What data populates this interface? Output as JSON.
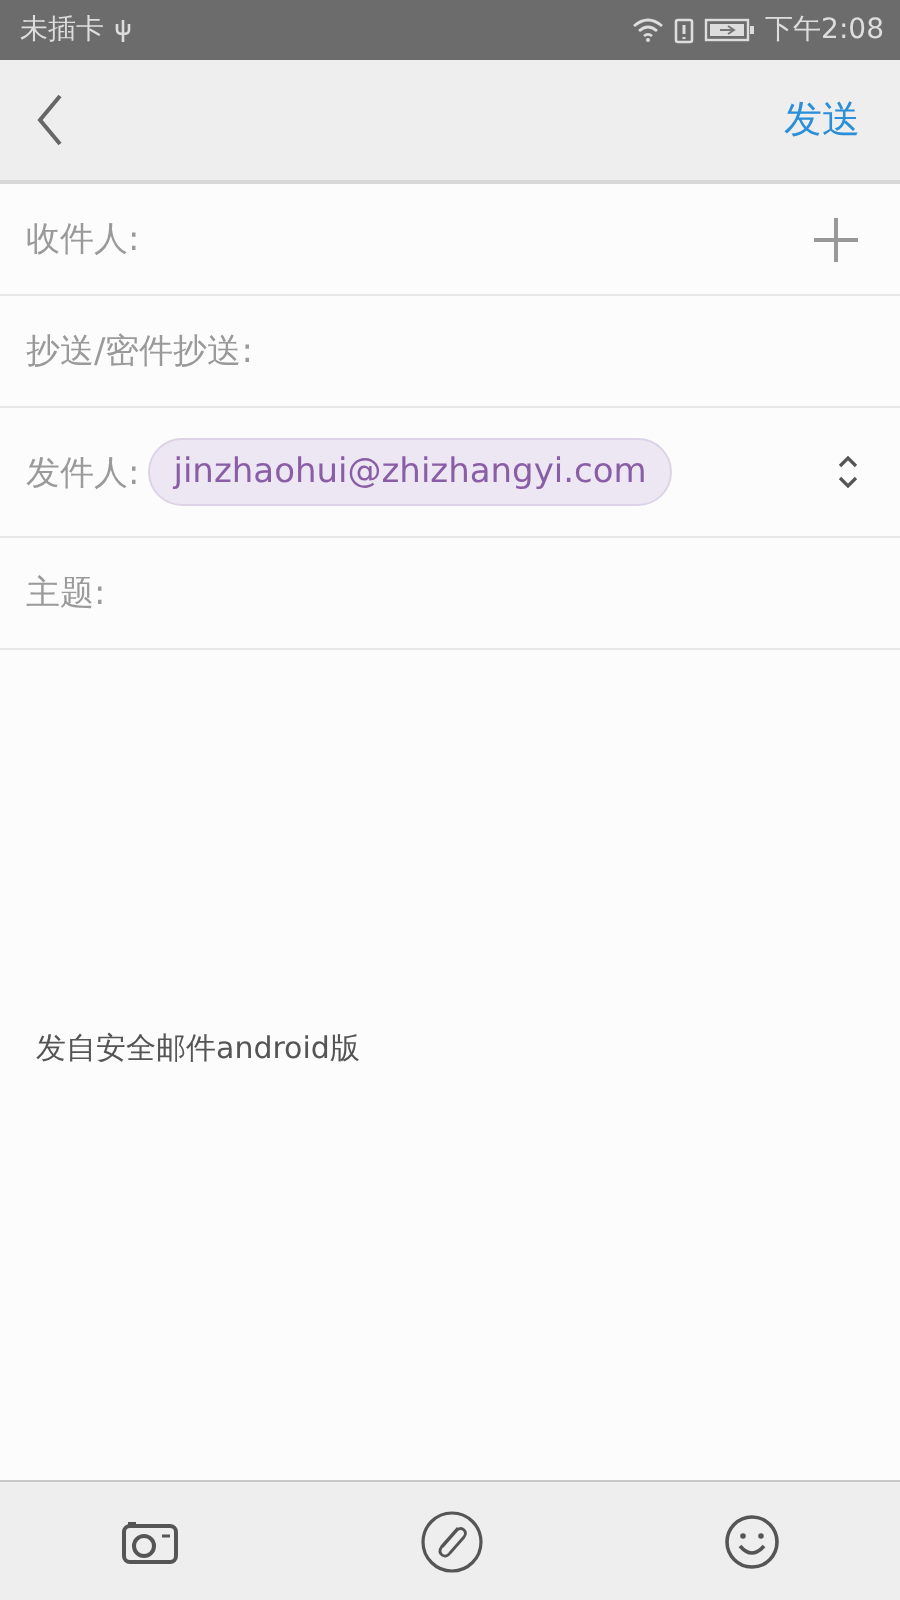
{
  "status_bar": {
    "carrier": "未插卡",
    "time": "下午2:08"
  },
  "header": {
    "send": "发送"
  },
  "fields": [
    {
      "kind": "add",
      "label": "收件人:"
    },
    {
      "kind": "plain",
      "label": "抄送/密件抄送:"
    },
    {
      "kind": "sender",
      "label": "发件人:",
      "value": "jinzhaohui@zhizhangyi.com"
    },
    {
      "kind": "plain",
      "label": "主题:"
    }
  ],
  "body": {
    "signature": "发自安全邮件android版"
  }
}
